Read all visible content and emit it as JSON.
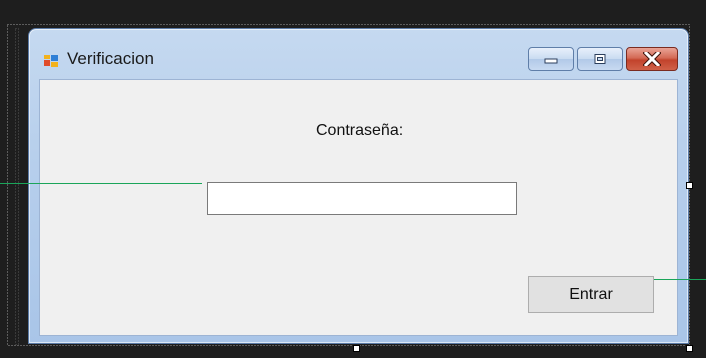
{
  "window": {
    "title": "Verificacion",
    "caption": {
      "minimize_icon": "minimize-icon",
      "maximize_icon": "maximize-icon",
      "close_icon": "close-x-icon"
    },
    "app_icon": "form-app-icon"
  },
  "form": {
    "password_label": "Contraseña:",
    "password_value": "",
    "enter_button_label": "Entrar"
  },
  "colors": {
    "designer_background": "#1e1e1e",
    "client_area": "#f0f0f0",
    "connector_line": "#1aa55a",
    "close_button": "#c2432c"
  }
}
